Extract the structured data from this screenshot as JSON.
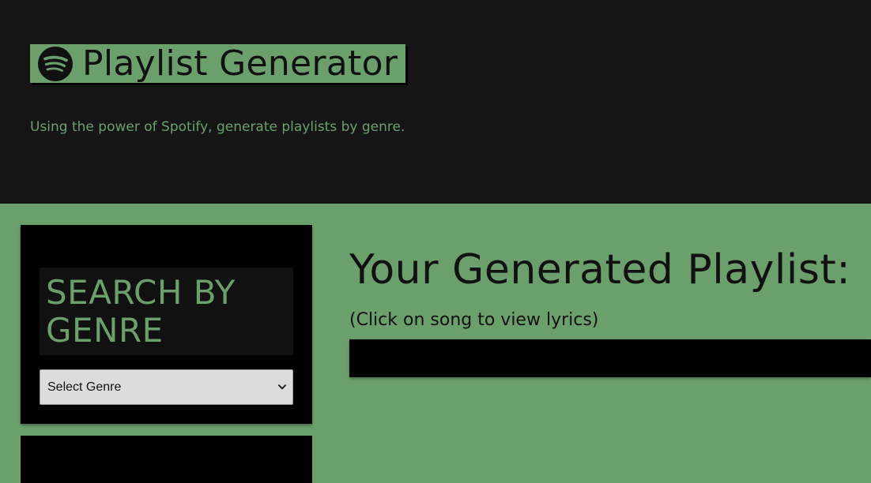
{
  "header": {
    "title": "Playlist Generator",
    "logo_icon": "spotify-icon",
    "subtitle": "Using the power of Spotify, generate playlists by genre."
  },
  "sidebar": {
    "heading": "SEARCH BY GENRE",
    "genre_select": {
      "selected": "Select Genre"
    }
  },
  "main": {
    "playlist_title": "Your Generated Playlist:",
    "playlist_hint": "(Click on song to view lyrics)"
  },
  "colors": {
    "header_bg": "#151515",
    "accent_green": "#6ba06c",
    "card_bg": "#000000"
  }
}
